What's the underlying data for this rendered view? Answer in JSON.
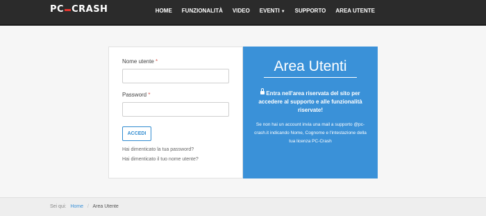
{
  "header": {
    "logo": {
      "left": "PC",
      "right": "CRASH"
    },
    "nav": [
      {
        "label": "HOME"
      },
      {
        "label": "FUNZIONALITÀ"
      },
      {
        "label": "VIDEO"
      },
      {
        "label": "EVENTI",
        "has_caret": true
      },
      {
        "label": "SUPPORTO"
      },
      {
        "label": "AREA UTENTE"
      }
    ]
  },
  "login": {
    "username_label": "Nome utente",
    "password_label": "Password",
    "required_mark": "*",
    "username_value": "",
    "password_value": "",
    "submit_label": "ACCEDI",
    "forgot_password": "Hai dimenticato la tua password?",
    "forgot_username": "Hai dimenticato il tuo nome utente?"
  },
  "info": {
    "title": "Area Utenti",
    "intro": "Entra nell'area riservata del sito per accedere al supporto e alle funzionalità riservate!",
    "info_part1": "Se non hai un account invia una mail a supporto @pc-crash.it indicando Nome, Cognome e l'intestazione della tua licenza PC-Crash"
  },
  "breadcrumb": {
    "prefix": "Sei qui:",
    "home": "Home",
    "separator": "/",
    "current": "Area Utente"
  },
  "colors": {
    "header_bg": "#2b2b2b",
    "accent": "#3a91d8",
    "logo_dash": "#e8352e"
  }
}
